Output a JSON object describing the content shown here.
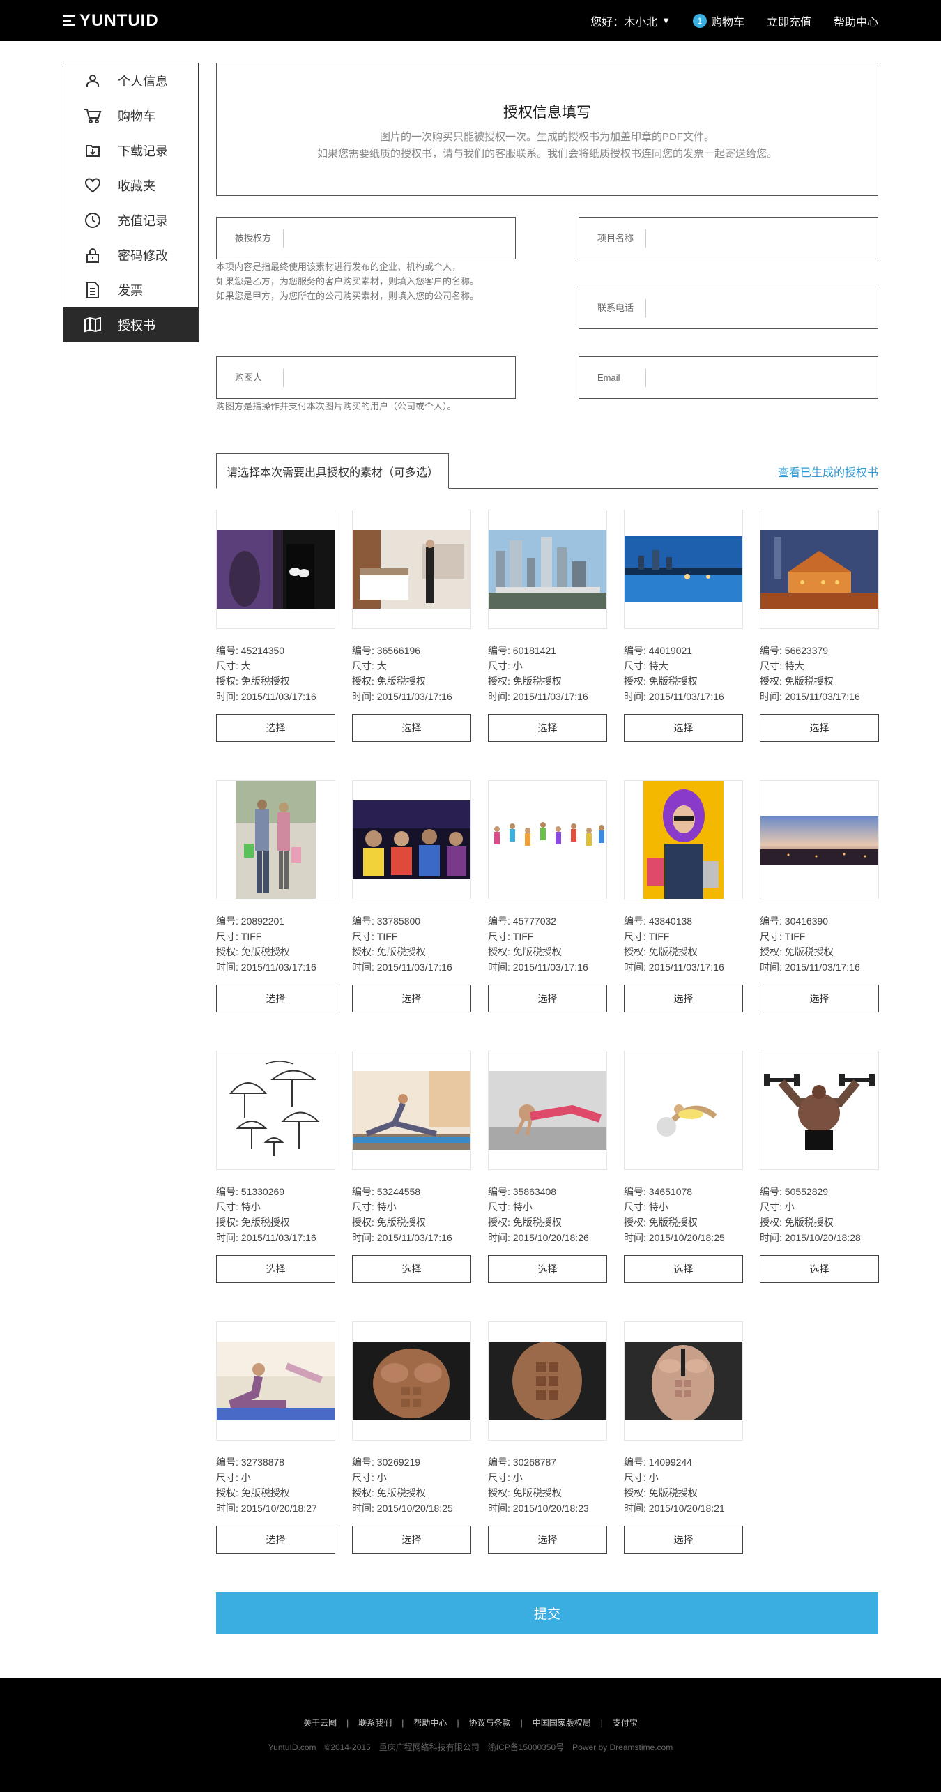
{
  "header": {
    "logo": "YUNTUID",
    "greeting": "您好：木小北",
    "cart_count": "1",
    "cart_label": "购物车",
    "recharge_label": "立即充值",
    "help_label": "帮助中心"
  },
  "sidebar": {
    "items": [
      {
        "label": "个人信息",
        "icon": "user-icon"
      },
      {
        "label": "购物车",
        "icon": "cart-icon"
      },
      {
        "label": "下载记录",
        "icon": "download-icon"
      },
      {
        "label": "收藏夹",
        "icon": "heart-icon"
      },
      {
        "label": "充值记录",
        "icon": "clock-icon"
      },
      {
        "label": "密码修改",
        "icon": "lock-icon"
      },
      {
        "label": "发票",
        "icon": "document-icon"
      },
      {
        "label": "授权书",
        "icon": "book-icon"
      }
    ]
  },
  "info": {
    "title": "授权信息填写",
    "line1": "图片的一次购买只能被授权一次。生成的授权书为加盖印章的PDF文件。",
    "line2": "如果您需要纸质的授权书，请与我们的客服联系。我们会将纸质授权书连同您的发票一起寄送给您。"
  },
  "form": {
    "licensee_label": "被授权方",
    "licensee_hint1": "本项内容是指最终使用该素材进行发布的企业、机构或个人，",
    "licensee_hint2": "如果您是乙方，为您服务的客户购买素材，则填入您客户的名称。",
    "licensee_hint3": "如果您是甲方，为您所在的公司购买素材，则填入您的公司名称。",
    "project_label": "项目名称",
    "phone_label": "联系电话",
    "buyer_label": "购图人",
    "buyer_hint": "购图方是指操作并支付本次图片购买的用户（公司或个人）。",
    "email_label": "Email"
  },
  "section": {
    "tab_label": "请选择本次需要出具授权的素材（可多选）",
    "view_link": "查看已生成的授权书"
  },
  "labels": {
    "id_prefix": "编号: ",
    "size_prefix": "尺寸: ",
    "license_prefix": "授权: ",
    "time_prefix": "时间: ",
    "select_button": "选择"
  },
  "items": [
    {
      "id": "45214350",
      "size": "大",
      "license": "免版税授权",
      "time": "2015/11/03/17:16",
      "thumb": "party-waiter"
    },
    {
      "id": "36566196",
      "size": "大",
      "license": "免版税授权",
      "time": "2015/11/03/17:16",
      "thumb": "hotel-room"
    },
    {
      "id": "60181421",
      "size": "小",
      "license": "免版税授权",
      "time": "2015/11/03/17:16",
      "thumb": "city-train"
    },
    {
      "id": "44019021",
      "size": "特大",
      "license": "免版税授权",
      "time": "2015/11/03/17:16",
      "thumb": "harbor-night"
    },
    {
      "id": "56623379",
      "size": "特大",
      "license": "免版税授权",
      "time": "2015/11/03/17:16",
      "thumb": "temple-lights"
    },
    {
      "id": "20892201",
      "size": "TIFF",
      "license": "免版税授权",
      "time": "2015/11/03/17:16",
      "thumb": "couple-shopping"
    },
    {
      "id": "33785800",
      "size": "TIFF",
      "license": "免版税授权",
      "time": "2015/11/03/17:16",
      "thumb": "cinema-audience"
    },
    {
      "id": "45777032",
      "size": "TIFF",
      "license": "免版税授权",
      "time": "2015/11/03/17:16",
      "thumb": "jumping-people"
    },
    {
      "id": "43840138",
      "size": "TIFF",
      "license": "免版税授权",
      "time": "2015/11/03/17:16",
      "thumb": "purple-hair-shopper"
    },
    {
      "id": "30416390",
      "size": "TIFF",
      "license": "免版税授权",
      "time": "2015/11/03/17:16",
      "thumb": "city-sunset"
    },
    {
      "id": "51330269",
      "size": "特小",
      "license": "免版税授权",
      "time": "2015/11/03/17:16",
      "thumb": "mushrooms-sketch"
    },
    {
      "id": "53244558",
      "size": "特小",
      "license": "免版税授权",
      "time": "2015/11/03/17:16",
      "thumb": "yoga-stretch"
    },
    {
      "id": "35863408",
      "size": "特小",
      "license": "免版税授权",
      "time": "2015/10/20/18:26",
      "thumb": "pushup-woman"
    },
    {
      "id": "34651078",
      "size": "特小",
      "license": "免版税授权",
      "time": "2015/10/20/18:25",
      "thumb": "fitness-ball"
    },
    {
      "id": "50552829",
      "size": "小",
      "license": "免版税授权",
      "time": "2015/10/20/18:28",
      "thumb": "dumbbell-back"
    },
    {
      "id": "32738878",
      "size": "小",
      "license": "免版税授权",
      "time": "2015/10/20/18:27",
      "thumb": "meditation"
    },
    {
      "id": "30269219",
      "size": "小",
      "license": "免版税授权",
      "time": "2015/10/20/18:25",
      "thumb": "muscle-torso"
    },
    {
      "id": "30268787",
      "size": "小",
      "license": "免版税授权",
      "time": "2015/10/20/18:23",
      "thumb": "abs-closeup"
    },
    {
      "id": "14099244",
      "size": "小",
      "license": "免版税授权",
      "time": "2015/10/20/18:21",
      "thumb": "gym-torso"
    }
  ],
  "submit_label": "提交",
  "footer": {
    "links": [
      "关于云图",
      "联系我们",
      "帮助中心",
      "协议与条款",
      "中国国家版权局",
      "支付宝"
    ],
    "copy": [
      "YuntuID.com",
      "©2014-2015",
      "重庆广程网络科技有限公司",
      "渝ICP备15000350号",
      "Power by Dreamstime.com"
    ]
  },
  "colors": {
    "accent": "#3aaee0",
    "link": "#2e9ad6",
    "header_bg": "#000000",
    "sidebar_active": "#2a2a2a"
  }
}
